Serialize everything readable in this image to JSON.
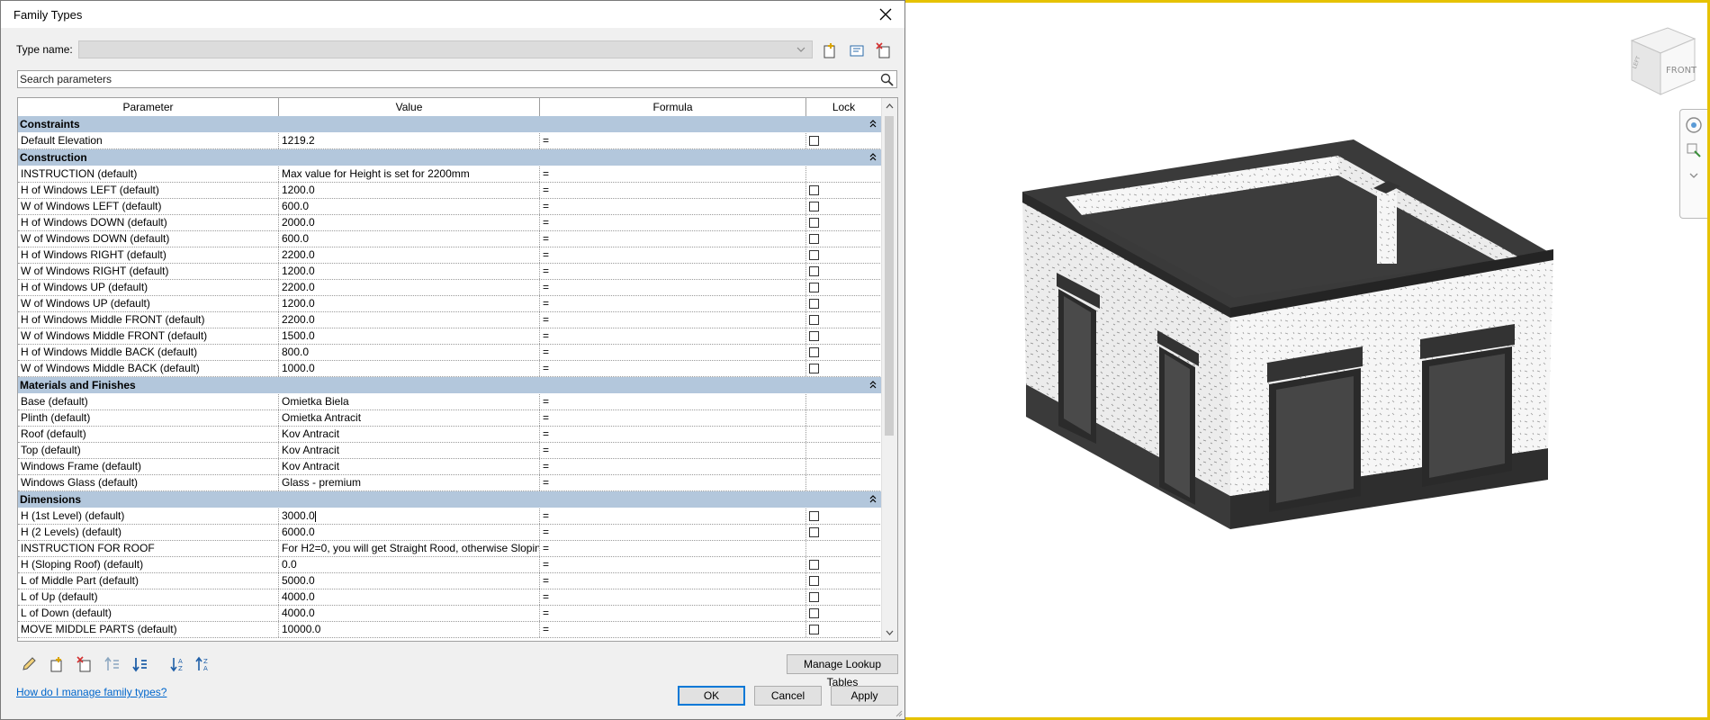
{
  "dialog": {
    "title": "Family Types",
    "type_name_label": "Type name:",
    "type_name_value": "",
    "search_placeholder": "Search parameters",
    "columns": [
      "Parameter",
      "Value",
      "Formula",
      "Lock"
    ],
    "groups": [
      {
        "name": "Constraints",
        "rows": [
          {
            "param": "Default Elevation",
            "value": "1219.2",
            "formula": "=",
            "lock": true
          }
        ]
      },
      {
        "name": "Construction",
        "rows": [
          {
            "param": "INSTRUCTION (default)",
            "value": "Max value for Height is set for 2200mm",
            "formula": "=",
            "lock": false
          },
          {
            "param": "H of Windows LEFT (default)",
            "value": "1200.0",
            "formula": "=",
            "lock": true
          },
          {
            "param": "W of Windows LEFT (default)",
            "value": "600.0",
            "formula": "=",
            "lock": true
          },
          {
            "param": "H of Windows DOWN (default)",
            "value": "2000.0",
            "formula": "=",
            "lock": true
          },
          {
            "param": "W of Windows DOWN (default)",
            "value": "600.0",
            "formula": "=",
            "lock": true
          },
          {
            "param": "H of Windows RIGHT (default)",
            "value": "2200.0",
            "formula": "=",
            "lock": true
          },
          {
            "param": "W of Windows RIGHT (default)",
            "value": "1200.0",
            "formula": "=",
            "lock": true
          },
          {
            "param": "H of Windows  UP (default)",
            "value": "2200.0",
            "formula": "=",
            "lock": true
          },
          {
            "param": "W of Windows UP (default)",
            "value": "1200.0",
            "formula": "=",
            "lock": true
          },
          {
            "param": "H of Windows Middle FRONT (default)",
            "value": "2200.0",
            "formula": "=",
            "lock": true
          },
          {
            "param": "W of Windows Middle FRONT (default)",
            "value": "1500.0",
            "formula": "=",
            "lock": true
          },
          {
            "param": "H of Windows Middle BACK (default)",
            "value": "800.0",
            "formula": "=",
            "lock": true
          },
          {
            "param": "W of Windows Middle BACK (default)",
            "value": "1000.0",
            "formula": "=",
            "lock": true
          }
        ]
      },
      {
        "name": "Materials and Finishes",
        "rows": [
          {
            "param": "Base (default)",
            "value": "Omietka Biela",
            "formula": "=",
            "lock": false
          },
          {
            "param": "Plinth (default)",
            "value": "Omietka Antracit",
            "formula": "=",
            "lock": false
          },
          {
            "param": "Roof (default)",
            "value": "Kov Antracit",
            "formula": "=",
            "lock": false
          },
          {
            "param": "Top (default)",
            "value": "Kov Antracit",
            "formula": "=",
            "lock": false
          },
          {
            "param": "Windows Frame (default)",
            "value": "Kov Antracit",
            "formula": "=",
            "lock": false
          },
          {
            "param": "Windows Glass (default)",
            "value": "Glass - premium",
            "formula": "=",
            "lock": false
          }
        ]
      },
      {
        "name": "Dimensions",
        "rows": [
          {
            "param": "H (1st Level) (default)",
            "value": "3000.0",
            "formula": "=",
            "lock": true,
            "editing": true
          },
          {
            "param": "H (2 Levels) (default)",
            "value": "6000.0",
            "formula": "=",
            "lock": true
          },
          {
            "param": "INSTRUCTION FOR ROOF",
            "value": "For H2=0, you will get Straight Rood, otherwise Sloping Roof",
            "formula": "=",
            "lock": false
          },
          {
            "param": "H (Sloping Roof) (default)",
            "value": "0.0",
            "formula": "=",
            "lock": true
          },
          {
            "param": "L of Middle Part (default)",
            "value": "5000.0",
            "formula": "=",
            "lock": true
          },
          {
            "param": "L of Up (default)",
            "value": "4000.0",
            "formula": "=",
            "lock": true
          },
          {
            "param": "L of Down (default)",
            "value": "4000.0",
            "formula": "=",
            "lock": true
          },
          {
            "param": "MOVE MIDDLE PARTS (default)",
            "value": "10000.0",
            "formula": "=",
            "lock": true
          }
        ]
      }
    ],
    "manage_lookup_label": "Manage Lookup Tables",
    "help_link": "How do I manage family types?",
    "ok_label": "OK",
    "cancel_label": "Cancel",
    "apply_label": "Apply"
  },
  "viewport": {
    "viewcube_face": "FRONT",
    "viewcube_corner": "LEFT"
  },
  "colors": {
    "group_header": "#b3c7dc",
    "viewport_border": "#e6c200",
    "roof": "#3a3a3a",
    "link": "#0066cc"
  }
}
